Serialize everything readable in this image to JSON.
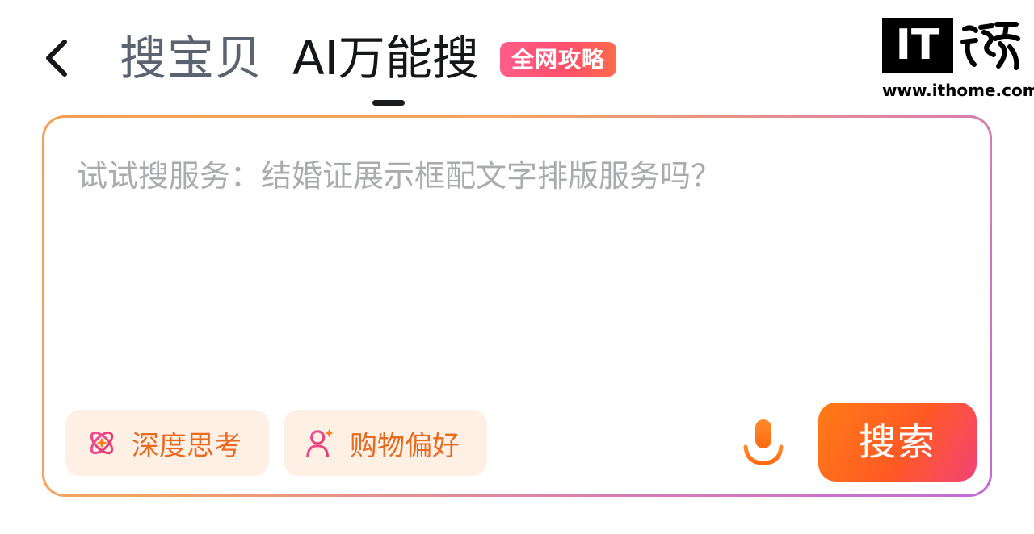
{
  "header": {
    "back_icon": "chevron-left-icon",
    "tabs": [
      {
        "label": "搜宝贝",
        "active": false
      },
      {
        "label": "AI万能搜",
        "active": true
      }
    ],
    "badge": "全网攻略"
  },
  "watermark": {
    "logo_text": "IT",
    "url": "www.ithome.com"
  },
  "search_card": {
    "placeholder": "试试搜服务：结婚证展示框配文字排版服务吗？",
    "chips": [
      {
        "label": "深度思考",
        "icon": "atom-sparkle-icon"
      },
      {
        "label": "购物偏好",
        "icon": "user-sparkle-icon"
      }
    ],
    "mic_icon": "microphone-icon",
    "search_button": "搜索"
  },
  "colors": {
    "accent_orange": "#ff6a1a",
    "badge_pink": "#ff4f6c",
    "chip_bg": "#fff0e6",
    "chip_text": "#e86a1f",
    "card_border_start": "#f3a053",
    "card_border_end": "#c26bd8"
  }
}
